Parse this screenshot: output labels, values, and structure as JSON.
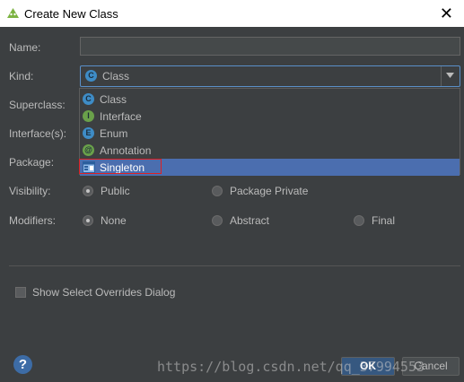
{
  "window": {
    "title": "Create New Class",
    "close": "✕"
  },
  "form": {
    "name_label": "Name:",
    "name_value": "",
    "kind_label": "Kind:",
    "kind_value": "Class",
    "superclass_label": "Superclass:",
    "interfaces_label": "Interface(s):",
    "package_label": "Package:",
    "visibility_label": "Visibility:",
    "modifiers_label": "Modifiers:"
  },
  "kind_options": [
    {
      "label": "Class",
      "icon": "class-icon",
      "color": "#3e8cc6",
      "glyph": "C"
    },
    {
      "label": "Interface",
      "icon": "interface-icon",
      "color": "#6aa14a",
      "glyph": "I"
    },
    {
      "label": "Enum",
      "icon": "enum-icon",
      "color": "#3e8cc6",
      "glyph": "E"
    },
    {
      "label": "Annotation",
      "icon": "annotation-icon",
      "color": "#6aa14a",
      "glyph": "@"
    },
    {
      "label": "Singleton",
      "icon": "singleton-icon",
      "color": "#4a86c8",
      "glyph": "",
      "selected": true
    }
  ],
  "visibility": {
    "public": "Public",
    "package_private": "Package Private",
    "selected": "Public"
  },
  "modifiers": {
    "none": "None",
    "abstract": "Abstract",
    "final": "Final",
    "selected": "None"
  },
  "overrides_checkbox": {
    "label": "Show Select Overrides Dialog",
    "checked": false
  },
  "buttons": {
    "help": "?",
    "ok": "OK",
    "cancel": "Cancel"
  },
  "watermark": "https://blog.csdn.net/qq_37994553",
  "colors": {
    "selection": "#4b6eaf",
    "highlight_box": "#e02020",
    "focus_border": "#5a8fc8"
  }
}
